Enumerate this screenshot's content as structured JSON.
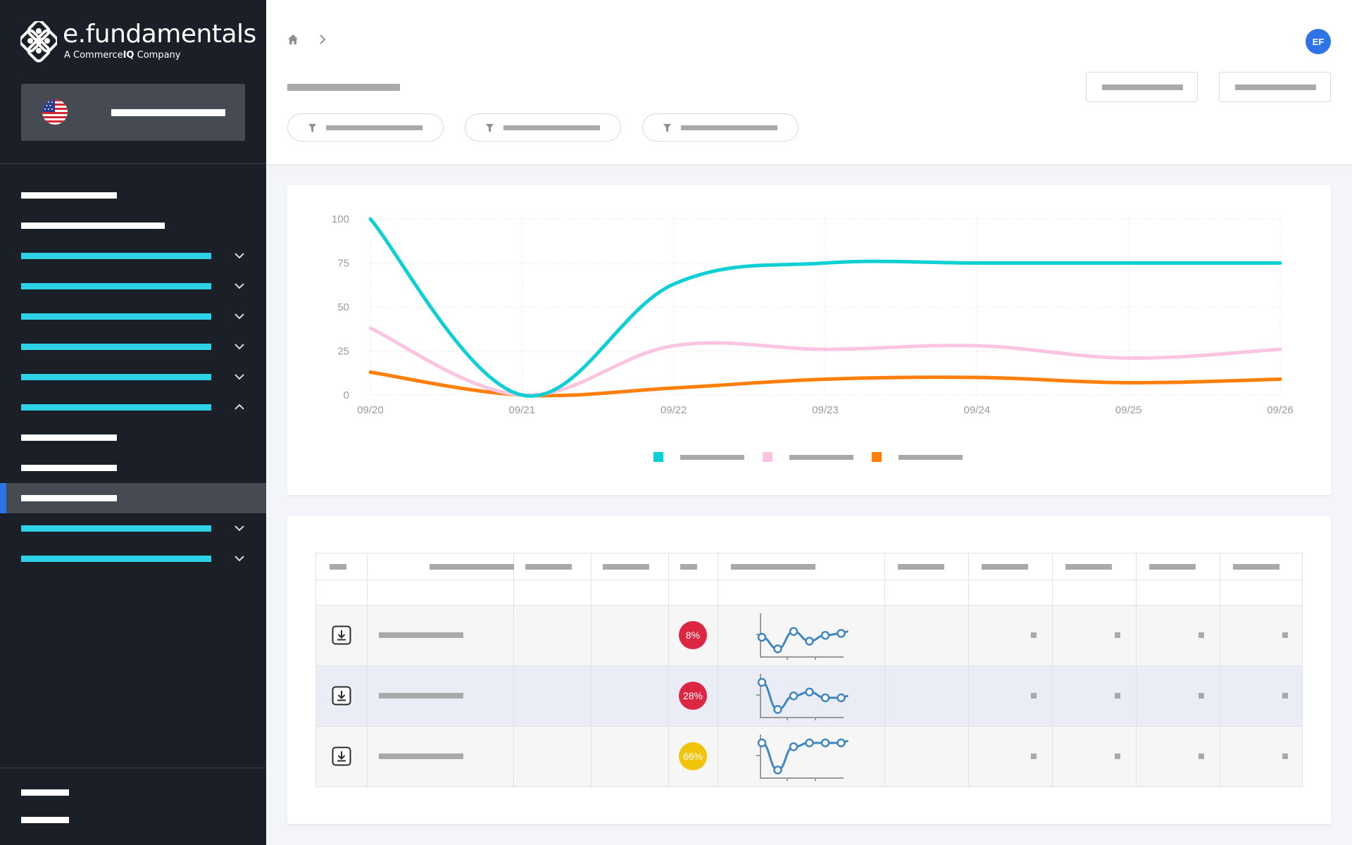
{
  "brand": {
    "name": "e.fundamentals",
    "tagline_prefix": "A Commerce",
    "tagline_bold": "IQ",
    "tagline_suffix": " Company"
  },
  "sidebar": {
    "region_flag": "us-flag-icon",
    "items": [
      {
        "style": "white"
      },
      {
        "style": "white"
      },
      {
        "style": "cyan",
        "chevron": "down"
      },
      {
        "style": "cyan",
        "chevron": "down"
      },
      {
        "style": "cyan",
        "chevron": "down"
      },
      {
        "style": "cyan",
        "chevron": "down"
      },
      {
        "style": "cyan",
        "chevron": "down"
      },
      {
        "style": "cyan",
        "chevron": "up"
      },
      {
        "style": "white"
      },
      {
        "style": "white"
      },
      {
        "style": "white",
        "active": true
      },
      {
        "style": "cyan",
        "chevron": "down"
      },
      {
        "style": "cyan",
        "chevron": "down"
      }
    ]
  },
  "header": {
    "avatar_initials": "EF",
    "breadcrumb_icons": [
      "home-icon",
      "chevron-right-icon"
    ],
    "filter_icon": "filter-icon"
  },
  "colors": {
    "sidebar_bg": "#1b1f27",
    "accent_blue": "#2e73e8",
    "nav_cyan": "#2dd2e6",
    "series_cyan": "#0dcfd4",
    "series_pink": "#fbc5e2",
    "series_orange": "#ff7f0a",
    "badge_red": "#dc2642",
    "badge_yellow": "#f2c40c"
  },
  "chart_data": {
    "type": "line",
    "x": [
      "09/20",
      "09/21",
      "09/22",
      "09/23",
      "09/24",
      "09/25",
      "09/26"
    ],
    "y_ticks": [
      "0",
      "25",
      "50",
      "75",
      "100"
    ],
    "ylim": [
      0,
      100
    ],
    "grid": true,
    "legend_position": "bottom-center",
    "series": [
      {
        "color": "#0dcfd4",
        "values": [
          100,
          0,
          63,
          75,
          75,
          75,
          75
        ]
      },
      {
        "color": "#fbc5e2",
        "values": [
          38,
          0,
          28,
          26,
          28,
          21,
          26
        ]
      },
      {
        "color": "#ff7f0a",
        "values": [
          13,
          0,
          4,
          9,
          10,
          7,
          9
        ]
      }
    ]
  },
  "table": {
    "rows": [
      {
        "badge": "8%",
        "badge_color": "#dc2642",
        "spark": [
          40,
          10,
          55,
          30,
          45,
          50
        ]
      },
      {
        "badge": "28%",
        "badge_color": "#dc2642",
        "spark": [
          80,
          10,
          45,
          55,
          40,
          40
        ]
      },
      {
        "badge": "66%",
        "badge_color": "#f2c40c",
        "spark": [
          80,
          10,
          70,
          80,
          80,
          80
        ]
      }
    ]
  }
}
